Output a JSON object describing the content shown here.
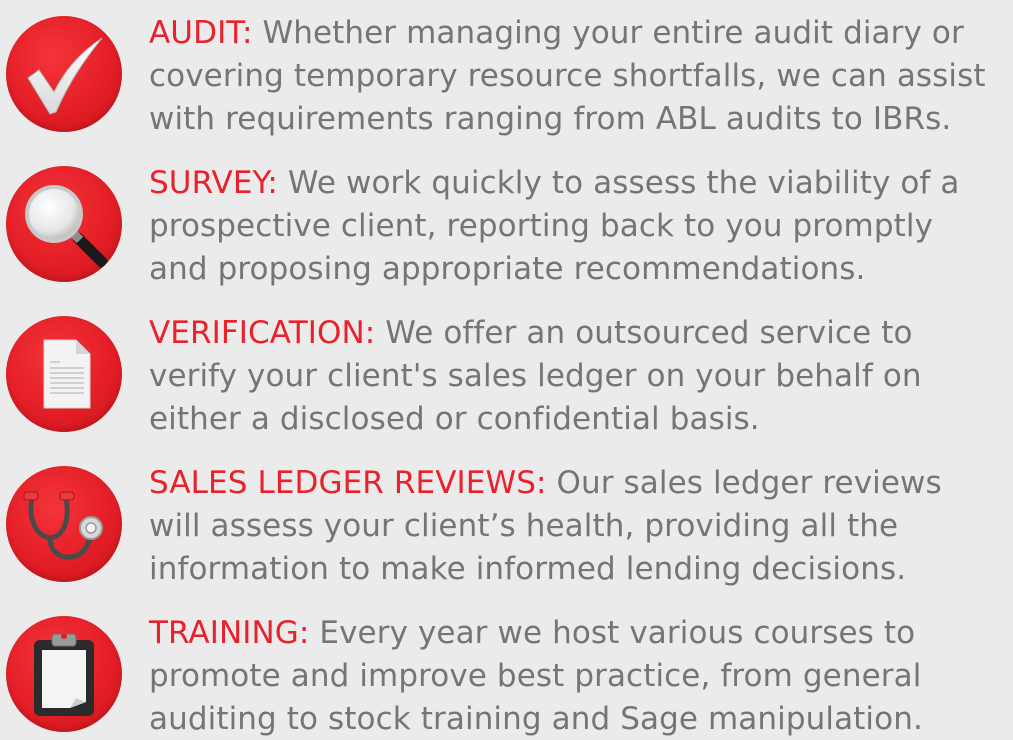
{
  "accent_color": "#e8212b",
  "text_color": "#757575",
  "background_color": "#ebebeb",
  "services": [
    {
      "icon": "checkmark-icon",
      "heading": "AUDIT:",
      "description": " Whether managing your entire audit diary or\ncovering temporary resource shortfalls, we can assist\nwith requirements ranging from ABL audits to IBRs."
    },
    {
      "icon": "magnifier-icon",
      "heading": "SURVEY:",
      "description": " We work quickly to assess the viability of a\nprospective client, reporting back to you promptly\nand proposing appropriate recommendations."
    },
    {
      "icon": "document-icon",
      "heading": "VERIFICATION:",
      "description": " We offer an outsourced service to\nverify your client's sales ledger on your behalf on\neither a disclosed or confidential basis."
    },
    {
      "icon": "stethoscope-icon",
      "heading": "SALES LEDGER REVIEWS:",
      "description": " Our sales ledger reviews\nwill assess your client’s health, providing all the\ninformation to make informed lending decisions."
    },
    {
      "icon": "clipboard-icon",
      "heading": "TRAINING:",
      "description": " Every year we host various courses to\npromote and improve best practice, from general\nauditing to stock training and Sage manipulation."
    }
  ]
}
